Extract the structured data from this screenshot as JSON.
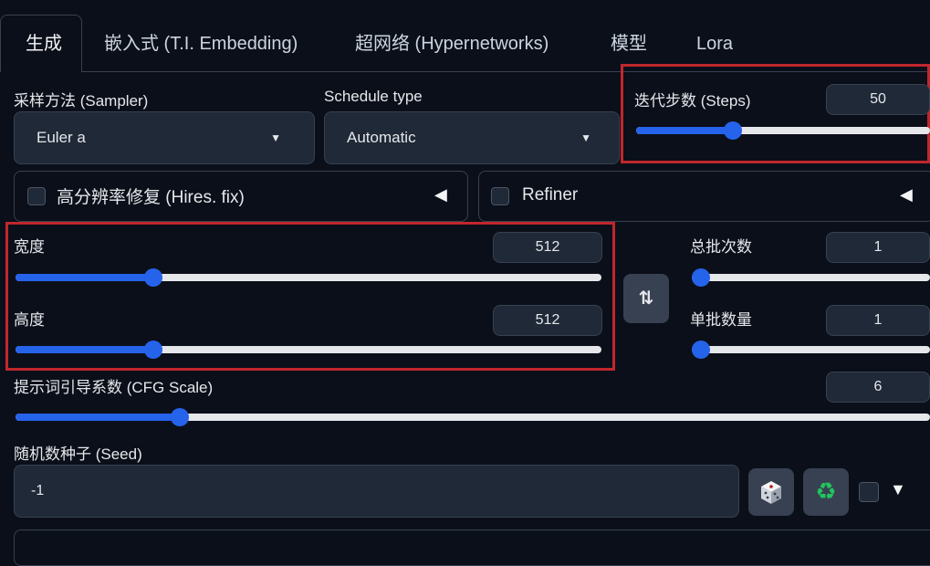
{
  "tabs": [
    {
      "label": "生成"
    },
    {
      "label": "嵌入式 (T.I. Embedding)"
    },
    {
      "label": "超网络 (Hypernetworks)"
    },
    {
      "label": "模型"
    },
    {
      "label": "Lora"
    }
  ],
  "sampler": {
    "label": "采样方法 (Sampler)",
    "value": "Euler a"
  },
  "schedule": {
    "label": "Schedule type",
    "value": "Automatic"
  },
  "steps": {
    "label": "迭代步数 (Steps)",
    "value": "50",
    "fraction": 0.33
  },
  "hires": {
    "label": "高分辨率修复 (Hires. fix)",
    "checked": false
  },
  "refiner": {
    "label": "Refiner",
    "checked": false
  },
  "width": {
    "label": "宽度",
    "value": "512",
    "fraction": 0.235
  },
  "height": {
    "label": "高度",
    "value": "512",
    "fraction": 0.235
  },
  "swap_button": {
    "icon": "swap-icon",
    "glyph": "⇅"
  },
  "batch_count": {
    "label": "总批次数",
    "value": "1",
    "fraction": 0.0
  },
  "batch_size": {
    "label": "单批数量",
    "value": "1",
    "fraction": 0.0
  },
  "cfg": {
    "label": "提示词引导系数 (CFG Scale)",
    "value": "6",
    "fraction": 0.18
  },
  "seed": {
    "label": "随机数种子 (Seed)",
    "value": "-1"
  },
  "seed_buttons": {
    "dice": "dice-icon",
    "recycle": "recycle-icon",
    "recycle_glyph": "♻"
  },
  "extra_toggle": {
    "glyph": "▼"
  },
  "accordion_glyph": "◀",
  "dropdown_glyph": "▼",
  "colors": {
    "accent": "#2563eb",
    "highlight": "#c0272d",
    "background": "#0b0f19",
    "panel": "#1f2937"
  }
}
